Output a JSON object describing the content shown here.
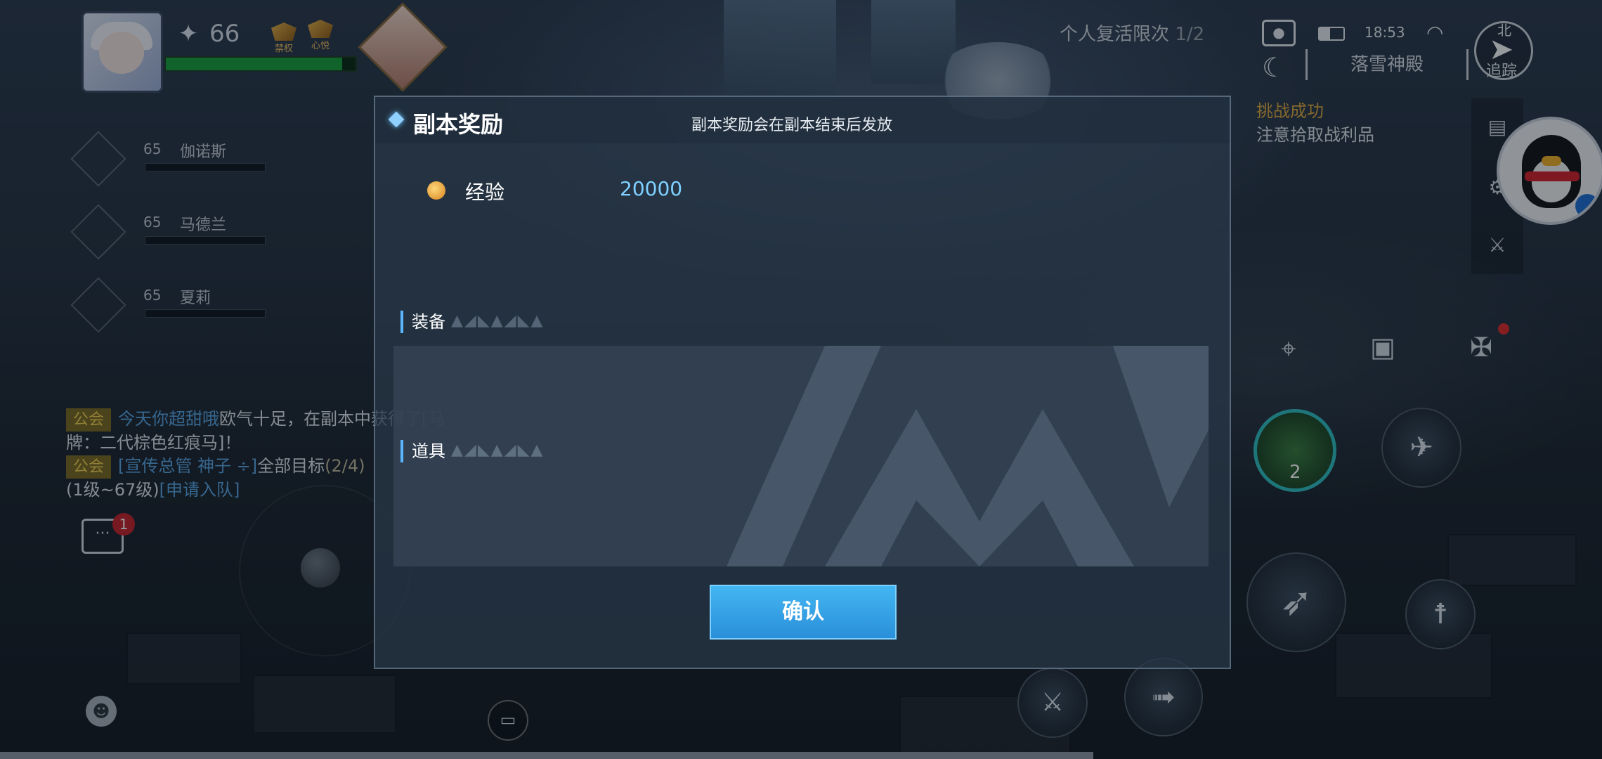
{
  "player": {
    "level": "66",
    "badge_a": "禁权",
    "badge_b": "心悦",
    "hp_fraction": 0.93
  },
  "team": [
    {
      "level": "65",
      "name": "伽诺斯"
    },
    {
      "level": "65",
      "name": "马德兰"
    },
    {
      "level": "65",
      "name": "夏莉"
    }
  ],
  "chat": {
    "line1_tag": "公会",
    "line1_user": "今天你超甜哦",
    "line1_text": "欧气十足，在副本中获得了[马牌：二代棕色红痕马]！",
    "line2_tag": "公会",
    "line2_user": "[宣传总管 神子 ÷]",
    "line2_text": "全部目标",
    "line2_progress": "(2/4)",
    "line3_text": "(1级~67级)",
    "line3_link": "[申请入队]",
    "unread_count": "1"
  },
  "hud": {
    "revive_label": "个人复活限次",
    "revive_count": "1/2",
    "time": "18:53",
    "location": "落雪神殿",
    "compass_north": "北",
    "compass_label": "追踪",
    "quest_title": "挑战成功",
    "quest_subtitle": "注意拾取战利品",
    "skill_charges": "2"
  },
  "dialog": {
    "title": "副本奖励",
    "notice": "副本奖励会在副本结束后发放",
    "exp_label": "经验",
    "exp_value": "20000",
    "section_equipment": "装备",
    "section_items": "道具",
    "confirm_label": "确认"
  },
  "colors": {
    "accent": "#3aa9ee",
    "quest_title": "#e1a93e",
    "exp_value": "#7fd0ff"
  }
}
